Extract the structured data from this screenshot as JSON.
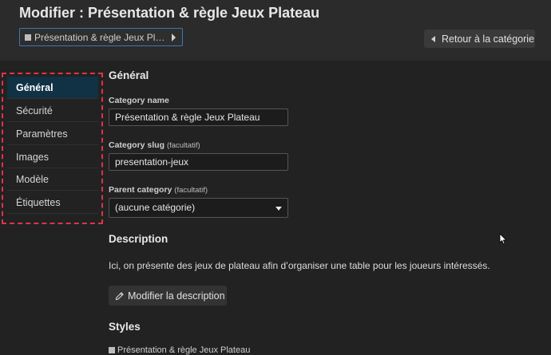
{
  "header": {
    "title": "Modifier : Présentation & règle Jeux Plateau",
    "breadcrumb_label": "Présentation & règle Jeux Plateau",
    "back_button": "Retour à la catégorie"
  },
  "sidebar": {
    "items": [
      {
        "label": "Général",
        "active": true
      },
      {
        "label": "Sécurité",
        "active": false
      },
      {
        "label": "Paramètres",
        "active": false
      },
      {
        "label": "Images",
        "active": false
      },
      {
        "label": "Modèle",
        "active": false
      },
      {
        "label": "Étiquettes",
        "active": false
      }
    ]
  },
  "general": {
    "heading": "Général",
    "name_label": "Category name",
    "name_value": "Présentation & règle Jeux Plateau",
    "slug_label": "Category slug",
    "slug_optional": "(facultatif)",
    "slug_value": "presentation-jeux",
    "parent_label": "Parent category",
    "parent_optional": "(facultatif)",
    "parent_value": "(aucune catégorie)"
  },
  "description": {
    "heading": "Description",
    "text": "Ici, on présente des jeux de plateau afin d’organiser une table pour les joueurs intéressés.",
    "edit_button": "Modifier la description"
  },
  "styles": {
    "heading": "Styles",
    "item_label": "Présentation & règle Jeux Plateau"
  },
  "colors": {
    "background": "#222222",
    "header": "#2b2b2b",
    "active_item": "#103244",
    "breadcrumb_border": "#3a78b5",
    "selection_outline": "#e0334a"
  },
  "icons": {
    "breadcrumb": "color-square-icon",
    "breadcrumb_arrow": "caret-right-icon",
    "back": "caret-left-icon",
    "edit": "pencil-icon",
    "select": "caret-down-icon"
  }
}
